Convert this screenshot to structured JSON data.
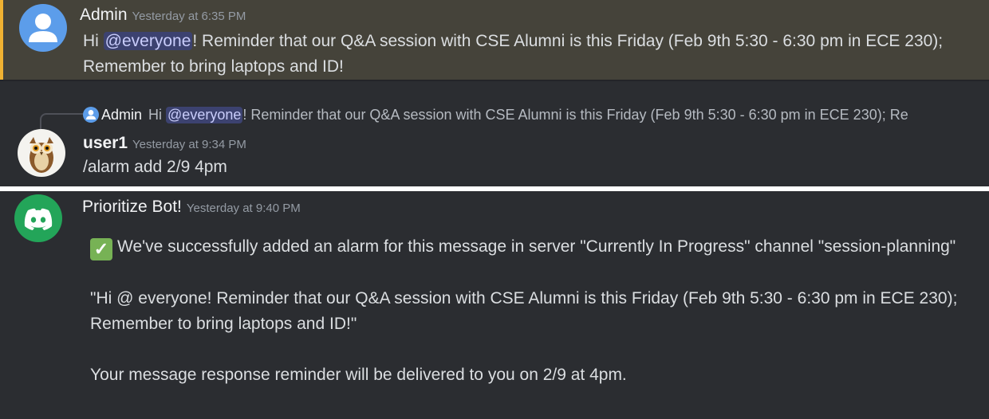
{
  "messages": {
    "admin": {
      "author": "Admin",
      "timestamp": "Yesterday at 6:35 PM",
      "text_before": "Hi ",
      "mention": "@everyone",
      "text_after": "! Reminder that our Q&A session with CSE Alumni is this Friday  (Feb 9th 5:30 - 6:30 pm in ECE 230); Remember to bring laptops and ID!"
    },
    "reply": {
      "ref_author": "Admin",
      "ref_before": "Hi ",
      "ref_mention": "@everyone",
      "ref_after": "! Reminder that our Q&A session with CSE Alumni is this Friday (Feb 9th 5:30 - 6:30 pm in ECE 230); Re",
      "author": "user1",
      "timestamp": "Yesterday at 9:34 PM",
      "text": "/alarm add 2/9 4pm"
    },
    "bot": {
      "author": "Prioritize Bot!",
      "timestamp": "Yesterday at 9:40 PM",
      "check_glyph": "✓",
      "line1": "We've successfully added an alarm for this message in server \"Currently In Progress\" channel \"session-planning\"",
      "quote": "\"Hi @ everyone! Reminder that our Q&A session with CSE Alumni is this Friday  (Feb 9th 5:30 - 6:30 pm in ECE 230); Remember to bring laptops and ID!\"",
      "footer": "Your message response reminder will be delivered to you on 2/9 at 4pm."
    }
  },
  "colors": {
    "highlight_bg": "#45433a",
    "highlight_bar": "#f0b232",
    "mention_bg": "#3c4270",
    "bot_avatar": "#23a559"
  },
  "icons": {
    "admin_avatar": "default-user-avatar-icon",
    "user1_avatar": "owl-avatar-icon",
    "bot_avatar": "discord-logo-icon",
    "check": "check-mark-icon"
  }
}
